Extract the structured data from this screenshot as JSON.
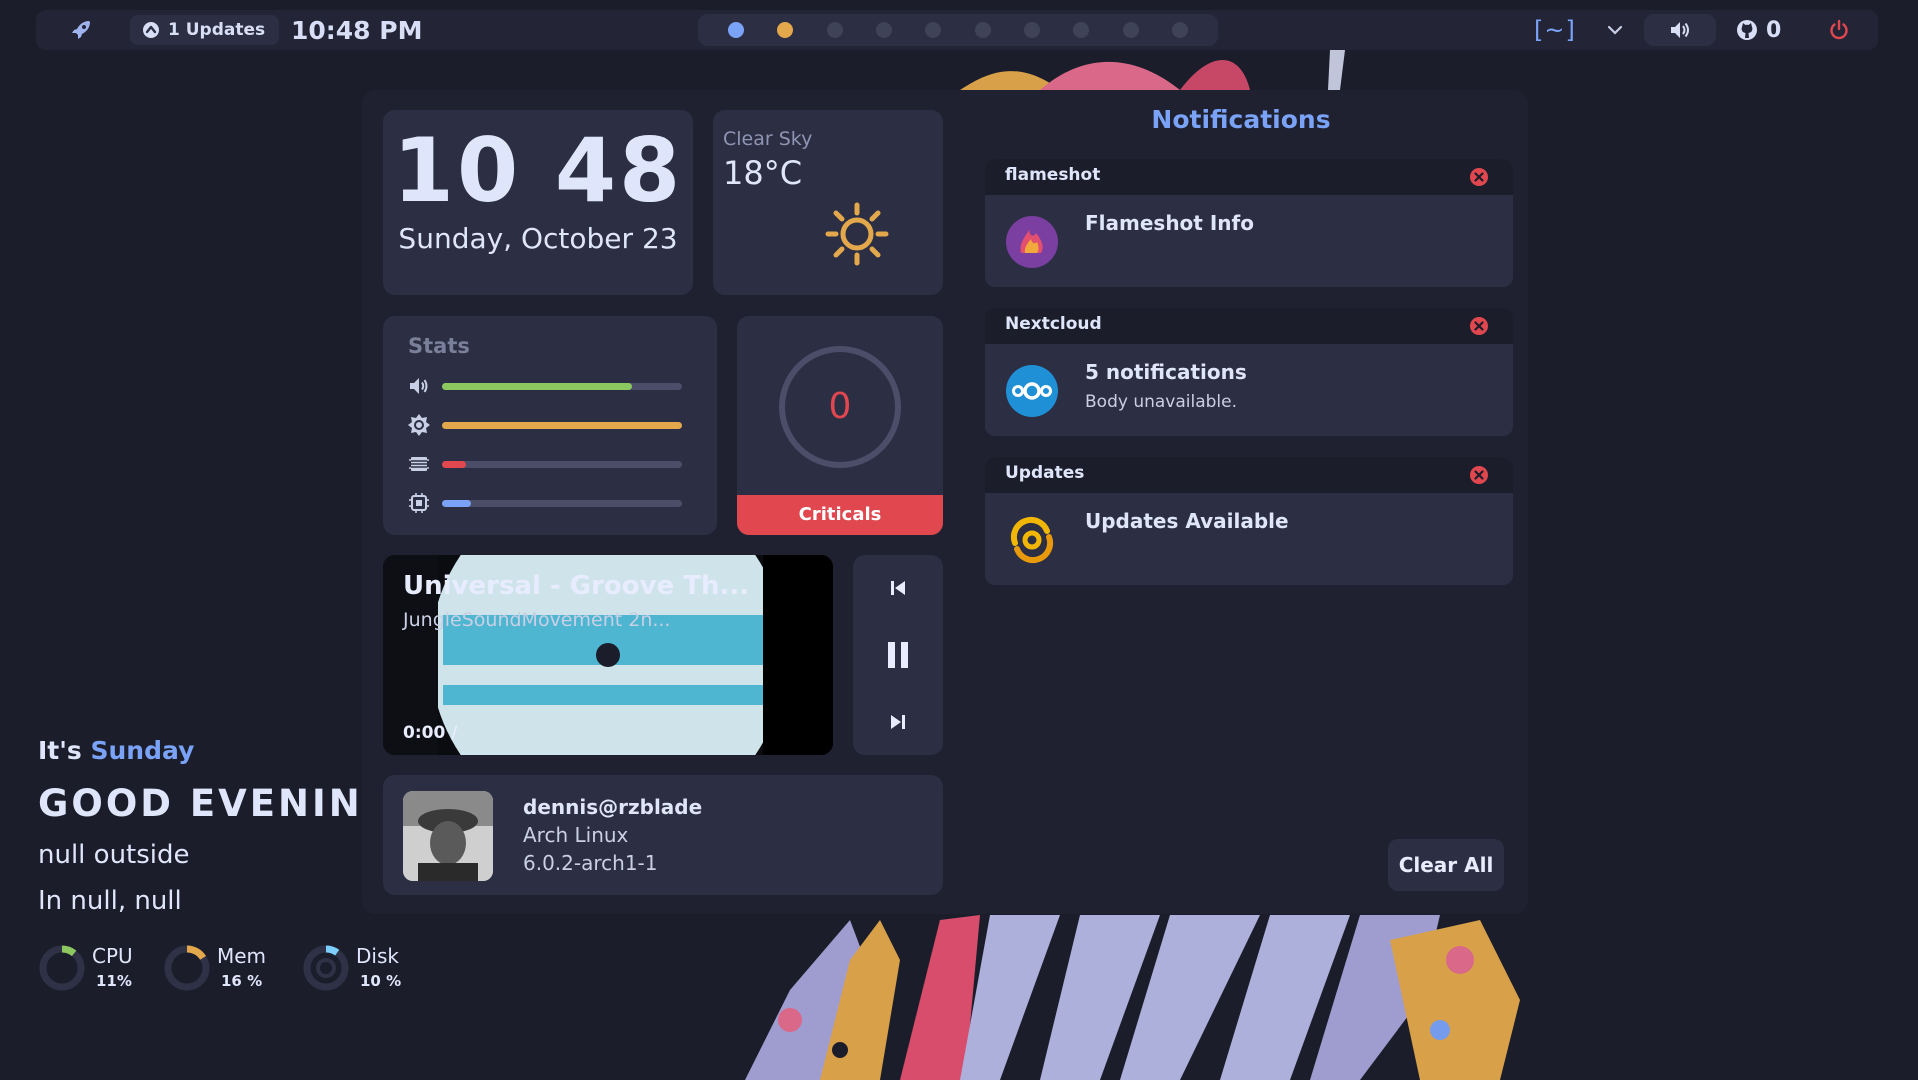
{
  "topbar": {
    "updates_label": "1 Updates",
    "time": "10:48 PM",
    "workspaces": [
      {
        "state": "active"
      },
      {
        "state": "occupied"
      },
      {
        "state": "empty"
      },
      {
        "state": "empty"
      },
      {
        "state": "empty"
      },
      {
        "state": "empty"
      },
      {
        "state": "empty"
      },
      {
        "state": "empty"
      },
      {
        "state": "empty"
      },
      {
        "state": "empty"
      }
    ],
    "terminal_label": "[~]",
    "github_count": "0",
    "icons": {
      "launcher": "rocket-icon",
      "updates": "arrow-up-circle-icon",
      "dropdown": "chevron-down-icon",
      "volume": "speaker-icon",
      "github": "github-icon",
      "power": "power-icon"
    }
  },
  "clock_card": {
    "time": "10 48",
    "date": "Sunday, October 23"
  },
  "weather_card": {
    "description": "Clear Sky",
    "temperature": "18°C",
    "icon": "sun-icon"
  },
  "stats": {
    "title": "Stats",
    "items": [
      {
        "name": "volume",
        "icon": "speaker-icon",
        "level": 0.79,
        "color": "#8cc85f"
      },
      {
        "name": "brightness",
        "icon": "brightness-icon",
        "level": 1.0,
        "color": "#e3a84b"
      },
      {
        "name": "memory",
        "icon": "memory-icon",
        "level": 0.1,
        "color": "#e0474f"
      },
      {
        "name": "cpu",
        "icon": "cpu-icon",
        "level": 0.12,
        "color": "#7aa2f7"
      }
    ]
  },
  "criticals": {
    "count": "0",
    "label": "Criticals"
  },
  "music": {
    "title": "Universal - Groove Th...",
    "artist": "JungleSoundMovement 2n...",
    "position": "0:00 /",
    "controls": {
      "previous": "skip-previous-icon",
      "pause": "pause-icon",
      "next": "skip-next-icon"
    }
  },
  "user": {
    "name": "dennis@rzblade",
    "os": "Arch Linux",
    "kernel": "6.0.2-arch1-1"
  },
  "notifications": {
    "title": "Notifications",
    "items": [
      {
        "app": "flameshot",
        "summary": "Flameshot Info",
        "body": "",
        "icon": "flameshot-icon"
      },
      {
        "app": "Nextcloud",
        "summary": "5 notifications",
        "body": "Body unavailable.",
        "icon": "nextcloud-icon"
      },
      {
        "app": "Updates",
        "summary": "Updates Available",
        "body": "",
        "icon": "updates-icon"
      }
    ],
    "clear_all": "Clear All"
  },
  "greeting": {
    "prefix": "It's ",
    "day": "Sunday",
    "salutation": "GOOD EVENING",
    "weather": "null outside",
    "location": "In null, null"
  },
  "resources": [
    {
      "name": "CPU",
      "value": "11%",
      "usage": 0.11,
      "color": "#8cc85f"
    },
    {
      "name": "Mem",
      "value": "16 %",
      "usage": 0.16,
      "color": "#e3a84b"
    },
    {
      "name": "Disk",
      "value": "10 %",
      "usage": 0.1,
      "color": "#7dcfff"
    }
  ],
  "colors": {
    "accent": "#7aa2f7",
    "critical": "#e0474f",
    "card": "#2c2f43",
    "background": "#1b1d2b"
  }
}
